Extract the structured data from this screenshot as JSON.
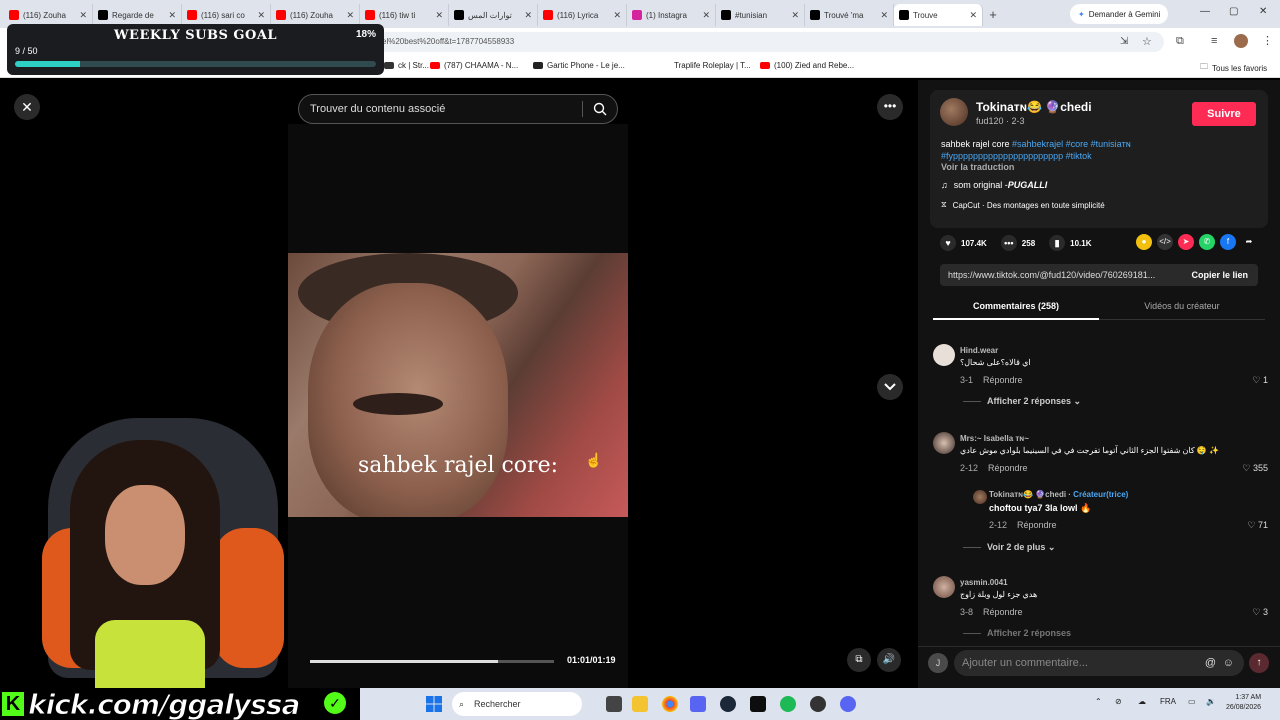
{
  "browser": {
    "tabs": [
      {
        "label": "(116) Zouha",
        "color": "#ff0000"
      },
      {
        "label": "Regarde de",
        "color": "#000000"
      },
      {
        "label": "(116) sari co",
        "color": "#ff0000"
      },
      {
        "label": "(116) Zouha",
        "color": "#ff0000"
      },
      {
        "label": "(116) tiw ti",
        "color": "#ff0000"
      },
      {
        "label": "توارات المس",
        "color": "#000000"
      },
      {
        "label": "(116) Lyrica",
        "color": "#ff0000"
      },
      {
        "label": "(1) Instagra",
        "color": "#d6249f"
      },
      {
        "label": "#tunisian",
        "color": "#000000"
      },
      {
        "label": "Trouvé 'ma",
        "color": "#000000"
      },
      {
        "label": "Trouve",
        "color": "#000000",
        "active": true
      }
    ],
    "gemini_label": "Demander à Gemini",
    "url": "el%20best%20off&t=1787704558933",
    "bookmarks": [
      {
        "label": "ck | Str...",
        "color": "#333333"
      },
      {
        "label": "(787) CHAAMA - N...",
        "color": "#ff0000"
      },
      {
        "label": "Gartic Phone - Le je...",
        "color": "#222222"
      },
      {
        "label": "Traplife Roleplay | T...",
        "color": "#ffffff"
      },
      {
        "label": "(100) Zied and Rebe...",
        "color": "#ff0000"
      }
    ],
    "all_bookmarks": "Tous les favoris"
  },
  "goal": {
    "title": "WEEKLY SUBS GOAL",
    "percent_label": "18%",
    "count": "9 / 50",
    "progress": 0.18
  },
  "player": {
    "search_placeholder": "Trouver du contenu associé",
    "caption": "sahbek rajel core:",
    "time": "01:01/01:19",
    "progress": 0.77
  },
  "kick": {
    "text": "kick.com/ggalyssa"
  },
  "panel": {
    "username": "Tokinaᴛɴ😂 🔮chedi",
    "handle_meta": "fud120 · 2-3",
    "follow_label": "Suivre",
    "desc_text": "sahbek rajel core ",
    "desc_tags": "#sahbekrajel #core #tunisiaᴛɴ #fypppppppppppppppppppppp #tiktok",
    "translate": "Voir la traduction",
    "sound_prefix": "som original - ",
    "sound_artist": "PUGALLI",
    "capcut": "CapCut · Des montages en toute simplicité",
    "likes": "107.4K",
    "comments": "258",
    "saves": "10.1K",
    "link_url": "https://www.tiktok.com/@fud120/video/760269181...",
    "copy_label": "Copier le lien",
    "tab_comments": "Commentaires (258)",
    "tab_videos": "Vidéos du créateur",
    "comment_list": [
      {
        "name": "Hind.wear",
        "text": "اي قالاه؟على شحال؟",
        "date": "3-1",
        "reply": "Répondre",
        "likes": "1",
        "more": "Afficher 2 réponses"
      },
      {
        "name": "Mrs:~ Isabella ᴛɴ~",
        "text": "كان شفتوا الجزء الثاني آتوما تفرجت في في السينيما بلوادي موش عادي 🤤 ✨",
        "date": "2-12",
        "reply": "Répondre",
        "likes": "355"
      },
      {
        "name": "yasmin.0041",
        "text": "هدي جزء لول وبلة زاوج",
        "date": "3-8",
        "reply": "Répondre",
        "likes": "3",
        "more": "Afficher 2 réponses"
      }
    ],
    "reply": {
      "name": "Tokinaᴛɴ😂 🔮chedi · ",
      "badge": "Créateur(trice)",
      "text": "choftou tya7 3la lowl 🔥",
      "date": "2-12",
      "reply": "Répondre",
      "likes": "71",
      "more": "Voir 2 de plus"
    },
    "input_avatar": "J",
    "input_placeholder": "Ajouter un commentaire..."
  },
  "taskbar": {
    "search": "Rechercher",
    "lang": "FRA",
    "time": "1:37 AM",
    "date": "26/08/2026"
  },
  "colors": {
    "accent": "#fe2c55",
    "tags": "#4aa8f4",
    "kick": "#53fc18",
    "goal_fill": "#2ed0c5"
  }
}
